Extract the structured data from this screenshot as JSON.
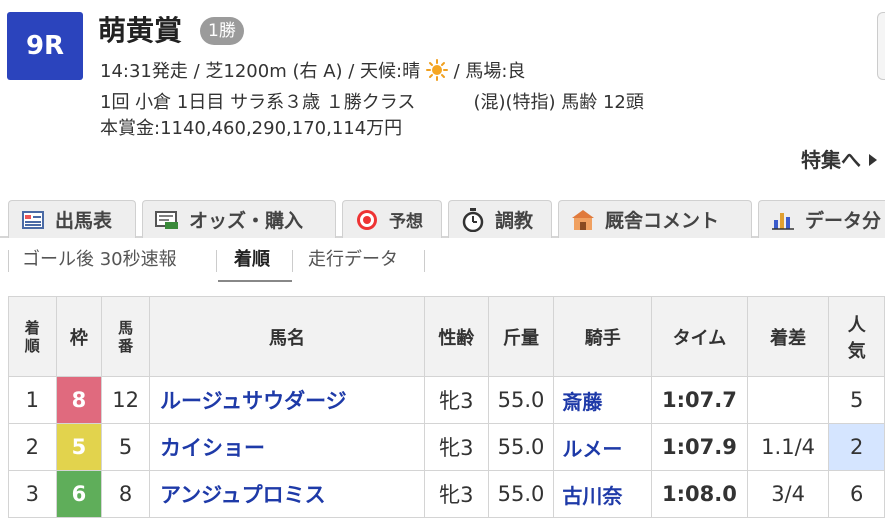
{
  "race": {
    "number": "9R",
    "title": "萌黄賞",
    "class_badge": "1勝",
    "line1_a": "14:31発走 / 芝1200m (右 A) / 天候:晴",
    "line1_b": "/ 馬場:良",
    "line2_a": "1回 小倉 1日目 サラ系３歳 １勝クラス",
    "line2_b": "(混)(特指) 馬齢 12頭",
    "line3": "本賞金:1140,460,290,170,114万円",
    "weather_icon": "sun-icon"
  },
  "feature_link": "特集へ",
  "tabs": [
    {
      "label": "出馬表",
      "icon": "table-icon"
    },
    {
      "label": "オッズ・購入",
      "icon": "ipat-icon"
    },
    {
      "label": "予想",
      "icon": "target-icon"
    },
    {
      "label": "調教",
      "icon": "stopwatch-icon"
    },
    {
      "label": "厩舎コメント",
      "icon": "stable-icon"
    },
    {
      "label": "データ分",
      "icon": "bar-chart-icon"
    }
  ],
  "subtabs": [
    {
      "label": "ゴール後 30秒速報"
    },
    {
      "label": "着順"
    },
    {
      "label": "走行データ"
    }
  ],
  "table": {
    "headers": {
      "rank": [
        "着",
        "順"
      ],
      "frame": "枠",
      "number": [
        "馬",
        "番"
      ],
      "name": "馬名",
      "sexage": "性齢",
      "weight": "斤量",
      "jockey": "騎手",
      "time": "タイム",
      "margin": "着差",
      "pop": [
        "人",
        "気"
      ]
    },
    "rows": [
      {
        "rank": "1",
        "frame": "8",
        "frame_color": "#e06a7e",
        "number": "12",
        "name": "ルージュサウダージ",
        "sexage": "牝3",
        "weight": "55.0",
        "jockey": "斎藤",
        "time": "1:07.7",
        "margin": "",
        "pop": "5"
      },
      {
        "rank": "2",
        "frame": "5",
        "frame_color": "#e2d34d",
        "number": "5",
        "name": "カイショー",
        "sexage": "牝3",
        "weight": "55.0",
        "jockey": "ルメー",
        "time": "1:07.9",
        "margin": "1.1/4",
        "pop": "2"
      },
      {
        "rank": "3",
        "frame": "6",
        "frame_color": "#5fae5a",
        "number": "8",
        "name": "アンジュプロミス",
        "sexage": "牝3",
        "weight": "55.0",
        "jockey": "古川奈",
        "time": "1:08.0",
        "margin": "3/4",
        "pop": "6"
      }
    ]
  },
  "colors": {
    "race_badge": "#2b44bd",
    "link_blue": "#1e3aa8",
    "highlight_pop": "#d5e5ff"
  }
}
